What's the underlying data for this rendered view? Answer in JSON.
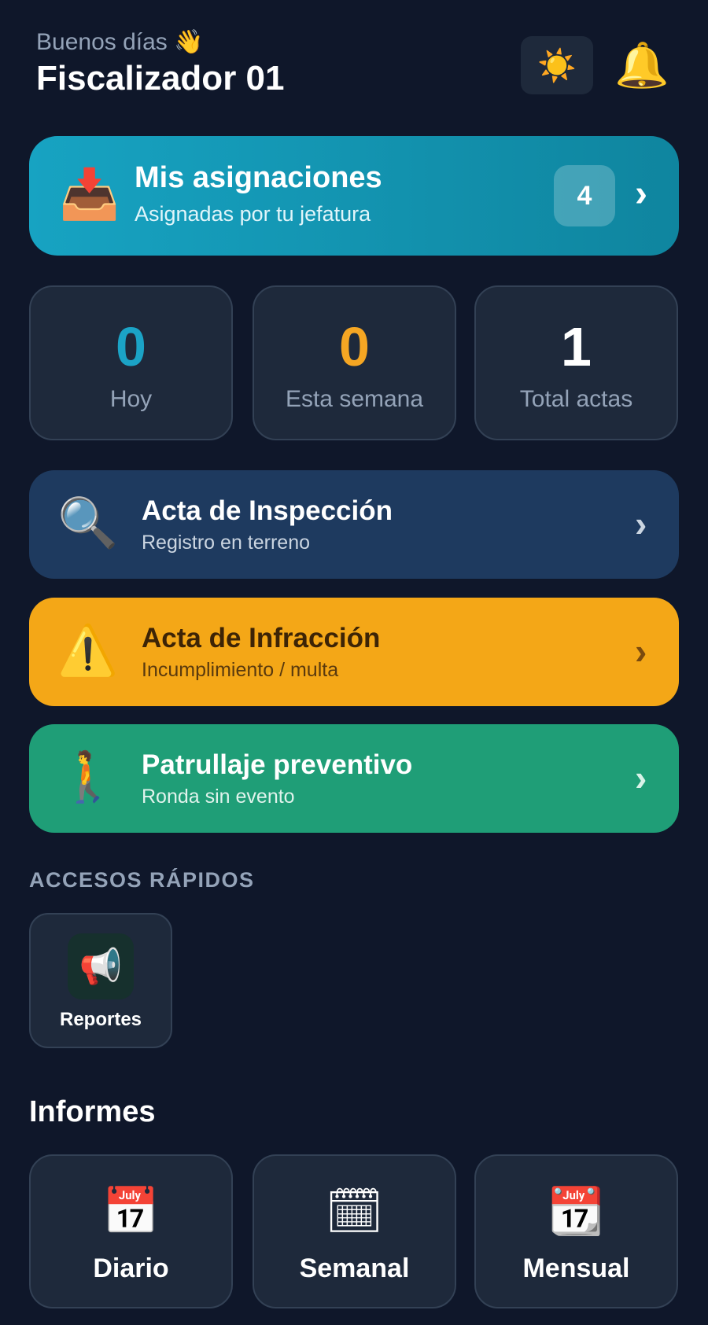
{
  "header": {
    "greeting": "Buenos días 👋",
    "user_name": "Fiscalizador 01",
    "theme_icon": "☀️",
    "bell_icon": "🔔"
  },
  "assignments": {
    "icon": "📥",
    "title": "Mis asignaciones",
    "subtitle": "Asignadas por tu jefatura",
    "count": "4",
    "chevron": "›"
  },
  "stats": [
    {
      "value": "0",
      "label": "Hoy",
      "color": "#1ba3c6"
    },
    {
      "value": "0",
      "label": "Esta semana",
      "color": "#f5a623"
    },
    {
      "value": "1",
      "label": "Total actas",
      "color": "#ffffff"
    }
  ],
  "actions": [
    {
      "icon": "🔍",
      "title": "Acta de Inspección",
      "subtitle": "Registro en terreno",
      "chevron": "›",
      "bg": "#1e3a5f",
      "title_color": "#ffffff",
      "sub_color": "#cbd5e1",
      "chevron_color": "#cbd5e1"
    },
    {
      "icon": "⚠️",
      "title": "Acta de Infracción",
      "subtitle": "Incumplimiento / multa",
      "chevron": "›",
      "bg": "#f4a717",
      "title_color": "#3d2406",
      "sub_color": "#5a3a0e",
      "chevron_color": "#7a4a0e"
    },
    {
      "icon": "🚶",
      "title": "Patrullaje preventivo",
      "subtitle": "Ronda sin evento",
      "chevron": "›",
      "bg": "#1f9e77",
      "title_color": "#ffffff",
      "sub_color": "#e0f3ec",
      "chevron_color": "#d8f2e8"
    }
  ],
  "quick_access": {
    "section_label": "ACCESOS RÁPIDOS",
    "items": [
      {
        "icon": "📢",
        "label": "Reportes"
      }
    ]
  },
  "reports": {
    "title": "Informes",
    "items": [
      {
        "icon": "📅",
        "label": "Diario"
      },
      {
        "icon": "🗓",
        "label": "Semanal"
      },
      {
        "icon": "📆",
        "label": "Mensual"
      }
    ]
  }
}
